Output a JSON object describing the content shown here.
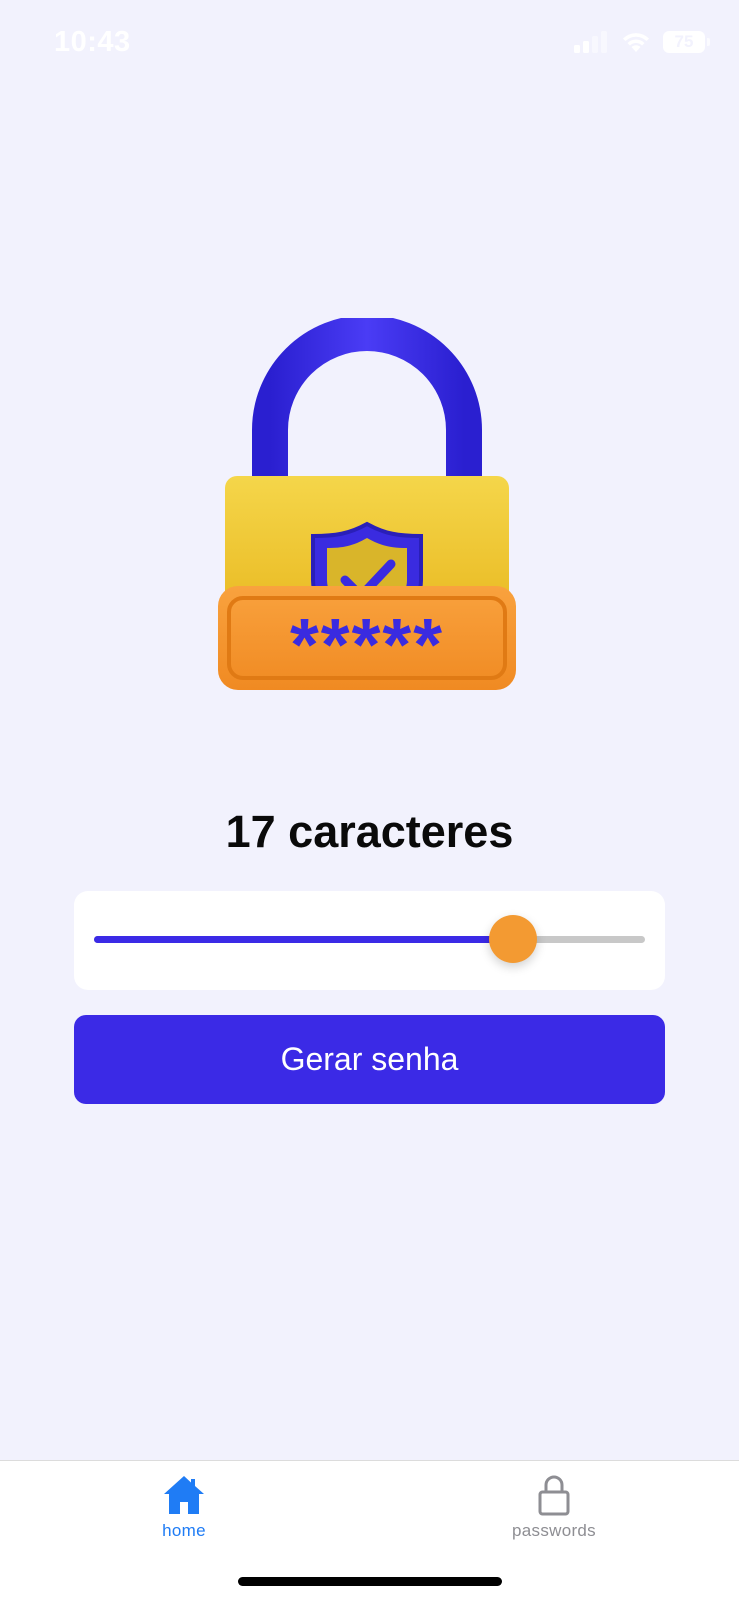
{
  "status_bar": {
    "time": "10:43",
    "battery_level": "75",
    "icons": [
      "signal-icon",
      "wifi-icon",
      "battery-icon"
    ]
  },
  "illustration": {
    "name": "padlock-password-illustration",
    "masked_text": "*****"
  },
  "generator": {
    "length_label": "17 caracteres",
    "slider_value_fraction": 0.76,
    "generate_button_label": "Gerar senha"
  },
  "tab_bar": {
    "items": [
      {
        "label": "home",
        "icon": "house-icon",
        "active": true
      },
      {
        "label": "passwords",
        "icon": "lock-icon",
        "active": false
      }
    ]
  },
  "colors": {
    "background": "#f2f2fd",
    "accent": "#3b2ae6",
    "slider_thumb": "#f39a32",
    "tab_active": "#1f7cf5",
    "tab_inactive": "#8e8e93"
  }
}
